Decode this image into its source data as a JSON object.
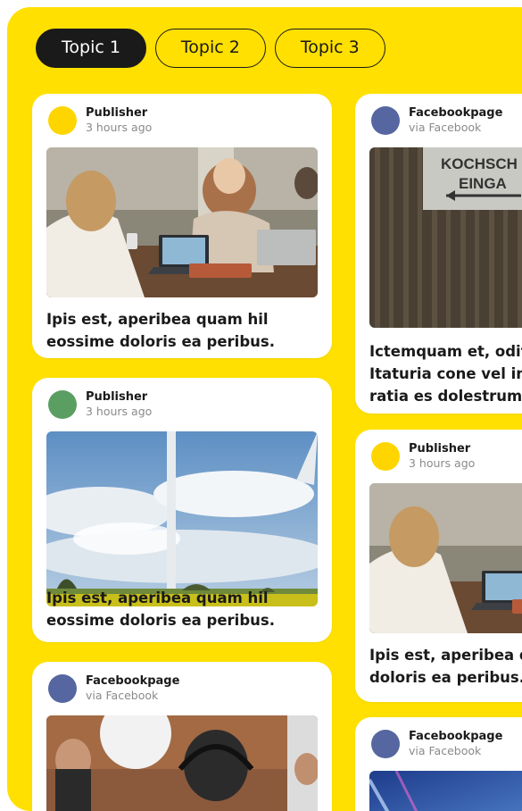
{
  "tabs": [
    {
      "label": "Topic 1",
      "active": true
    },
    {
      "label": "Topic 2",
      "active": false
    },
    {
      "label": "Topic 3",
      "active": false
    }
  ],
  "colors": {
    "background": "#ffe000",
    "avatar_publisher_yellow": "#ffd500",
    "avatar_publisher_green": "#5a9e62",
    "avatar_facebook": "#5566a0"
  },
  "cards": [
    {
      "avatar_color": "avatar_publisher_yellow",
      "author": "Publisher",
      "sub": "3 hours ago",
      "image": "people-laptops-photo",
      "headline": "Ipis est, aperibea quam hil eossi­me doloris ea peribus."
    },
    {
      "avatar_color": "avatar_publisher_green",
      "author": "Publisher",
      "sub": "3 hours ago",
      "image": "wind-turbine-photo",
      "headline": "Ipis est, aperibea quam hil eossi­me doloris ea peribus."
    },
    {
      "avatar_color": "avatar_facebook",
      "author": "Facebookpage",
      "sub": "via Facebook",
      "image": "video-shoot-photo",
      "headline": ""
    },
    {
      "avatar_color": "avatar_facebook",
      "author": "Facebookpage",
      "sub": "via Facebook",
      "image": "entrance-sign-photo",
      "headline": "Ictemquam et, odit Itaturia cone vel inv ratia es dolestrum",
      "image_text": "KOCHSCH EINGA"
    },
    {
      "avatar_color": "avatar_publisher_yellow",
      "author": "Publisher",
      "sub": "3 hours ago",
      "image": "people-laptops-photo",
      "headline": "Ipis est, aperibea q doloris ea peribus."
    },
    {
      "avatar_color": "avatar_facebook",
      "author": "Facebookpage",
      "sub": "via Facebook",
      "image": "concert-photo",
      "headline": ""
    }
  ]
}
